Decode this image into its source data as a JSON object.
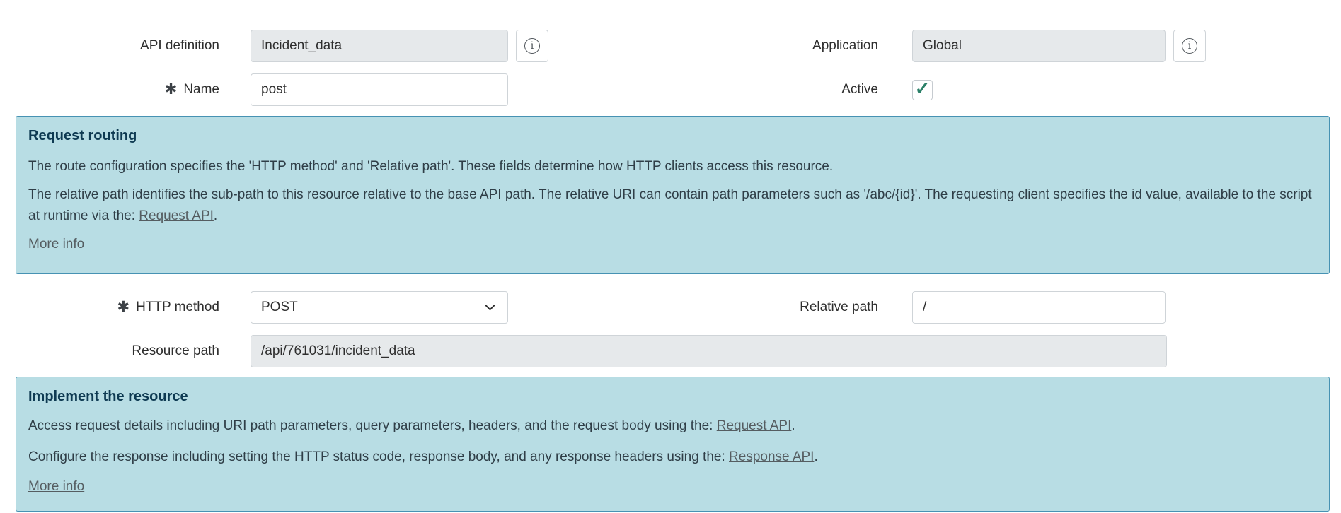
{
  "form": {
    "api_definition": {
      "label": "API definition",
      "value": "Incident_data"
    },
    "application": {
      "label": "Application",
      "value": "Global"
    },
    "name": {
      "label": "Name",
      "value": "post",
      "required": true
    },
    "active": {
      "label": "Active",
      "checked": true
    },
    "http_method": {
      "label": "HTTP method",
      "value": "POST",
      "required": true
    },
    "relative_path": {
      "label": "Relative path",
      "value": "/"
    },
    "resource_path": {
      "label": "Resource path",
      "value": "/api/761031/incident_data"
    }
  },
  "boxes": {
    "request_routing": {
      "title": "Request routing",
      "p1": "The route configuration specifies the 'HTTP method' and 'Relative path'. These fields determine how HTTP clients access this resource.",
      "p2_before": "The relative path identifies the sub-path to this resource relative to the base API path. The relative URI can contain path parameters such as '/abc/{id}'. The requesting client specifies the id value, available to the script at runtime via the: ",
      "p2_link": "Request API",
      "p2_after": ".",
      "more_info": "More info"
    },
    "implement_resource": {
      "title": "Implement the resource",
      "p1_before": "Access request details including URI path parameters, query parameters, headers, and the request body using the: ",
      "p1_link": "Request API",
      "p1_after": ".",
      "p2_before": "Configure the response including setting the HTTP status code, response body, and any response headers using the: ",
      "p2_link": "Response API",
      "p2_after": ".",
      "more_info": "More info"
    }
  },
  "icons": {
    "info_glyph": "i",
    "check_glyph": "✓",
    "required_glyph": "✱"
  },
  "colors": {
    "box_background": "#b8dde4",
    "box_border": "#4792b3",
    "box_title": "#0e3a52",
    "box_text": "#2f3e47",
    "link_color": "#555d61",
    "checkmark": "#2b8068",
    "input_border": "#cfd4d8",
    "readonly_background": "#e6e9eb",
    "label_text": "#2e2e2e"
  }
}
